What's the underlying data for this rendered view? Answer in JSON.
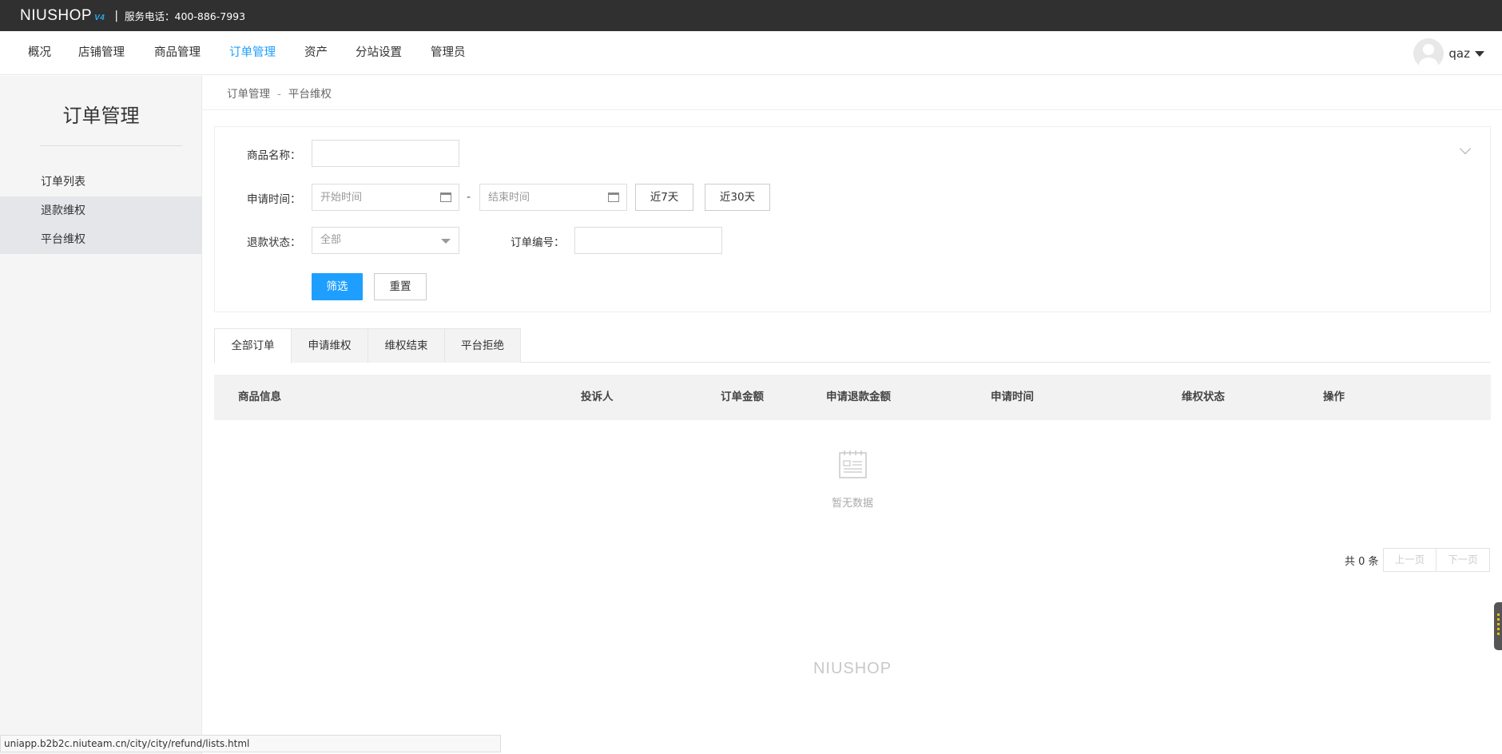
{
  "topbar": {
    "logo": "NIUSHOP",
    "logo_version": "V4",
    "separator": "|",
    "hotline": "服务电话：400-886-7993"
  },
  "nav": {
    "items": [
      {
        "label": "概况"
      },
      {
        "label": "店铺管理"
      },
      {
        "label": "商品管理"
      },
      {
        "label": "订单管理",
        "active": true
      },
      {
        "label": "资产"
      },
      {
        "label": "分站设置"
      },
      {
        "label": "管理员"
      }
    ],
    "user": {
      "name": "qaz"
    }
  },
  "sidebar": {
    "title": "订单管理",
    "items": [
      {
        "label": "订单列表"
      },
      {
        "label": "退款维权"
      },
      {
        "label": "平台维权",
        "selected": true
      }
    ]
  },
  "breadcrumb": {
    "parent": "订单管理",
    "separator": "-",
    "current": "平台维权"
  },
  "filter": {
    "product_name_label": "商品名称：",
    "product_name_value": "",
    "apply_time_label": "申请时间：",
    "start_placeholder": "开始时间",
    "range_dash": "-",
    "end_placeholder": "结束时间",
    "last7_label": "近7天",
    "last30_label": "近30天",
    "refund_status_label": "退款状态：",
    "refund_status_value": "全部",
    "order_no_label": "订单编号：",
    "order_no_value": "",
    "submit_label": "筛选",
    "reset_label": "重置"
  },
  "tabs": [
    {
      "label": "全部订单",
      "active": true
    },
    {
      "label": "申请维权"
    },
    {
      "label": "维权结束"
    },
    {
      "label": "平台拒绝"
    }
  ],
  "table": {
    "columns": [
      "商品信息",
      "投诉人",
      "订单金额",
      "申请退款金额",
      "申请时间",
      "维权状态",
      "操作"
    ],
    "empty_text": "暂无数据"
  },
  "pagination": {
    "total_text": "共 0 条",
    "prev_label": "上一页",
    "next_label": "下一页"
  },
  "footer": {
    "logo": "NIUSHOP"
  },
  "status_bar": {
    "url": "uniapp.b2b2c.niuteam.cn/city/city/refund/lists.html"
  },
  "colors": {
    "accent": "#1e9fff",
    "topbar": "#303030"
  }
}
